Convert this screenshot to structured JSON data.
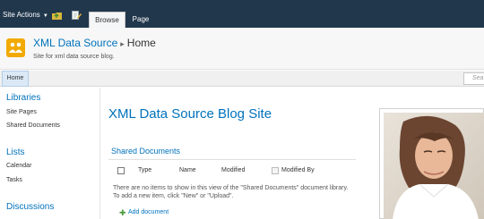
{
  "ribbon": {
    "site_actions": "Site Actions",
    "navigate_up_icon": "navigate-up-icon",
    "edit_icon": "edit-page-icon",
    "tabs": [
      {
        "label": "Browse",
        "selected": true
      },
      {
        "label": "Page",
        "selected": false
      }
    ]
  },
  "title_area": {
    "logo_icon": "site-logo-icon",
    "site_name": "XML Data Source",
    "separator": "▸",
    "page_name": "Home",
    "description": "Site for xml data source blog."
  },
  "topnav": {
    "home": "Home",
    "search_placeholder": "Sea"
  },
  "quicklaunch": {
    "sections": [
      {
        "heading": "Libraries",
        "items": [
          "Site Pages",
          "Shared Documents"
        ]
      },
      {
        "heading": "Lists",
        "items": [
          "Calendar",
          "Tasks"
        ]
      },
      {
        "heading": "Discussions",
        "items": []
      }
    ]
  },
  "main": {
    "page_title": "XML Data Source Blog Site",
    "webpart": {
      "title": "Shared Documents",
      "columns": [
        "Type",
        "Name",
        "Modified",
        "Modified By"
      ],
      "empty_message": "There are no items to show in this view of the \"Shared Documents\" document library. To add a new item, click \"New\" or \"Upload\".",
      "add_document": "Add document"
    }
  },
  "colors": {
    "ribbon_bg": "#21374c",
    "accent_blue": "#0072bc",
    "logo_orange": "#f2a900",
    "add_green": "#4a9a3a"
  }
}
